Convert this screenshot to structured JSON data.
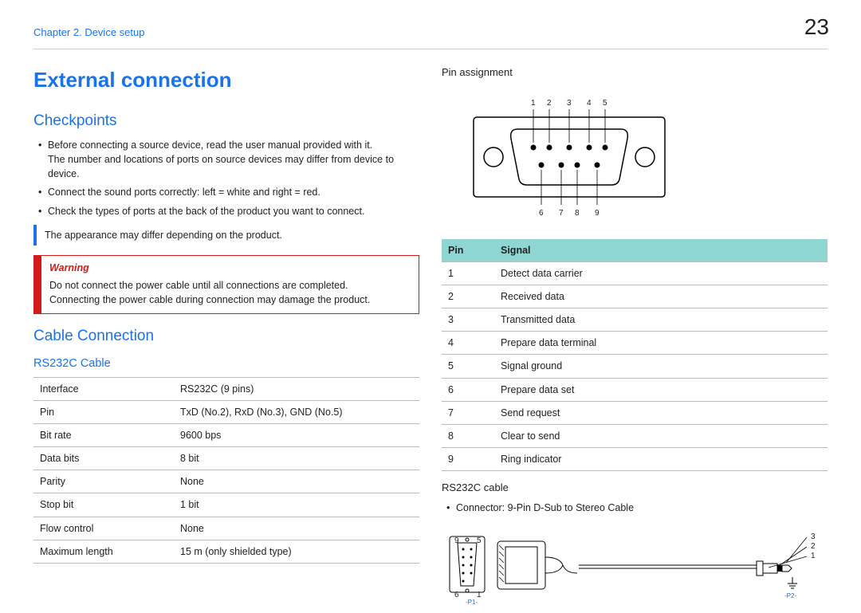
{
  "page_number": "23",
  "chapter": "Chapter 2. Device setup",
  "h1": "External connection",
  "checkpoints": {
    "heading": "Checkpoints",
    "items": [
      {
        "main": "Before connecting a source device, read the user manual provided with it.",
        "sub": "The number and locations of ports on source devices may differ from device to device."
      },
      {
        "main": "Connect the sound ports correctly: left = white and right = red."
      },
      {
        "main": "Check the types of ports at the back of the product you want to connect."
      }
    ],
    "note": "The appearance may differ depending on the product.",
    "warning_label": "Warning",
    "warning_lines": [
      "Do not connect the power cable until all connections are completed.",
      "Connecting the power cable during connection may damage the product."
    ]
  },
  "cable_connection": {
    "heading": "Cable Connection",
    "rs232c_heading": "RS232C Cable",
    "spec": [
      [
        "Interface",
        "RS232C (9 pins)"
      ],
      [
        "Pin",
        "TxD (No.2), RxD (No.3), GND (No.5)"
      ],
      [
        "Bit rate",
        "9600 bps"
      ],
      [
        "Data bits",
        "8 bit"
      ],
      [
        "Parity",
        "None"
      ],
      [
        "Stop bit",
        "1 bit"
      ],
      [
        "Flow control",
        "None"
      ],
      [
        "Maximum length",
        "15 m (only shielded type)"
      ]
    ]
  },
  "right": {
    "pin_assignment_heading": "Pin assignment",
    "connector": {
      "top_labels": [
        "1",
        "2",
        "3",
        "4",
        "5"
      ],
      "bottom_labels": [
        "6",
        "7",
        "8",
        "9"
      ]
    },
    "pin_table": {
      "head": [
        "Pin",
        "Signal"
      ],
      "rows": [
        [
          "1",
          "Detect data carrier"
        ],
        [
          "2",
          "Received data"
        ],
        [
          "3",
          "Transmitted data"
        ],
        [
          "4",
          "Prepare data terminal"
        ],
        [
          "5",
          "Signal ground"
        ],
        [
          "6",
          "Prepare data set"
        ],
        [
          "7",
          "Send request"
        ],
        [
          "8",
          "Clear to send"
        ],
        [
          "9",
          "Ring indicator"
        ]
      ]
    },
    "cable_heading": "RS232C cable",
    "cable_bullet": "Connector: 9-Pin D-Sub to Stereo Cable",
    "cable_fig": {
      "dsub_labels": {
        "tl": "9",
        "tr": "5",
        "bl": "6",
        "br": "1"
      },
      "jack_labels": [
        "3",
        "2",
        "1"
      ],
      "p1": "-P1-",
      "p2": "-P2-"
    }
  },
  "chart_data": {
    "type": "table",
    "description": "Pin assignment of RS232C 9-pin D-Sub connector",
    "columns": [
      "Pin",
      "Signal"
    ],
    "rows": [
      [
        1,
        "Detect data carrier"
      ],
      [
        2,
        "Received data"
      ],
      [
        3,
        "Transmitted data"
      ],
      [
        4,
        "Prepare data terminal"
      ],
      [
        5,
        "Signal ground"
      ],
      [
        6,
        "Prepare data set"
      ],
      [
        7,
        "Send request"
      ],
      [
        8,
        "Clear to send"
      ],
      [
        9,
        "Ring indicator"
      ]
    ]
  }
}
